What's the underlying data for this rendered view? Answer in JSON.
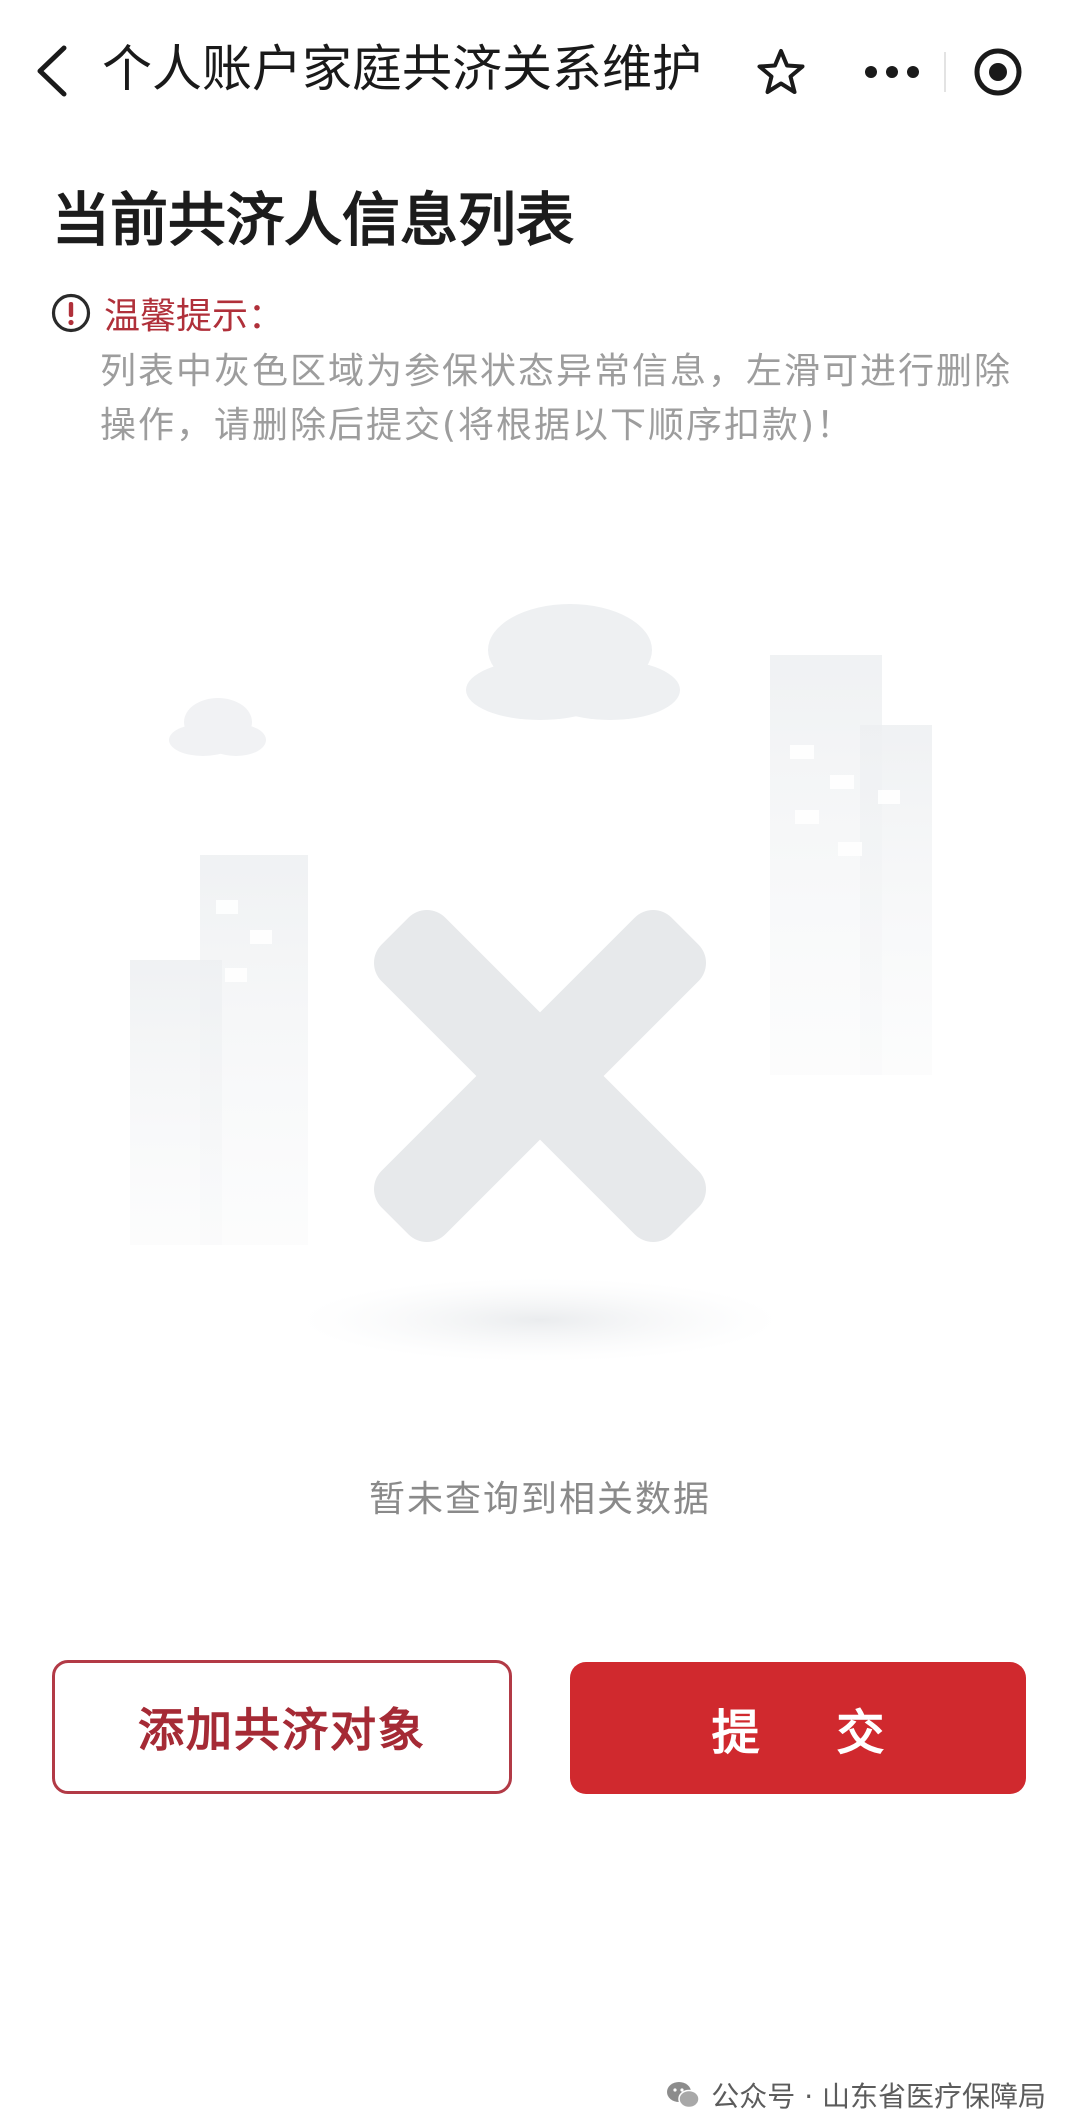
{
  "navbar": {
    "title": "个人账户家庭共济关系维护",
    "back_icon": "chevron-left-icon",
    "favorite_icon": "star-outline-icon",
    "more_icon": "more-dots-icon",
    "close_icon": "target-circle-icon"
  },
  "main": {
    "page_title": "当前共济人信息列表",
    "tip": {
      "label": "温馨提示：",
      "icon": "exclamation-circle-icon",
      "text": "列表中灰色区域为参保状态异常信息，左滑可进行删除操作，请删除后提交(将根据以下顺序扣款)！"
    },
    "empty_state": {
      "icon": "empty-x-illustration",
      "text": "暂未查询到相关数据"
    }
  },
  "actions": {
    "add_label": "添加共济对象",
    "submit_label": "提 交"
  },
  "watermark": {
    "text": "公众号 · 山东省医疗保障局",
    "icon": "wechat-logo-icon"
  },
  "colors": {
    "brand_red": "#d0292e",
    "outline_red": "#b23a46",
    "tip_red": "#b0303a",
    "gray_text": "#9d9d9d"
  }
}
